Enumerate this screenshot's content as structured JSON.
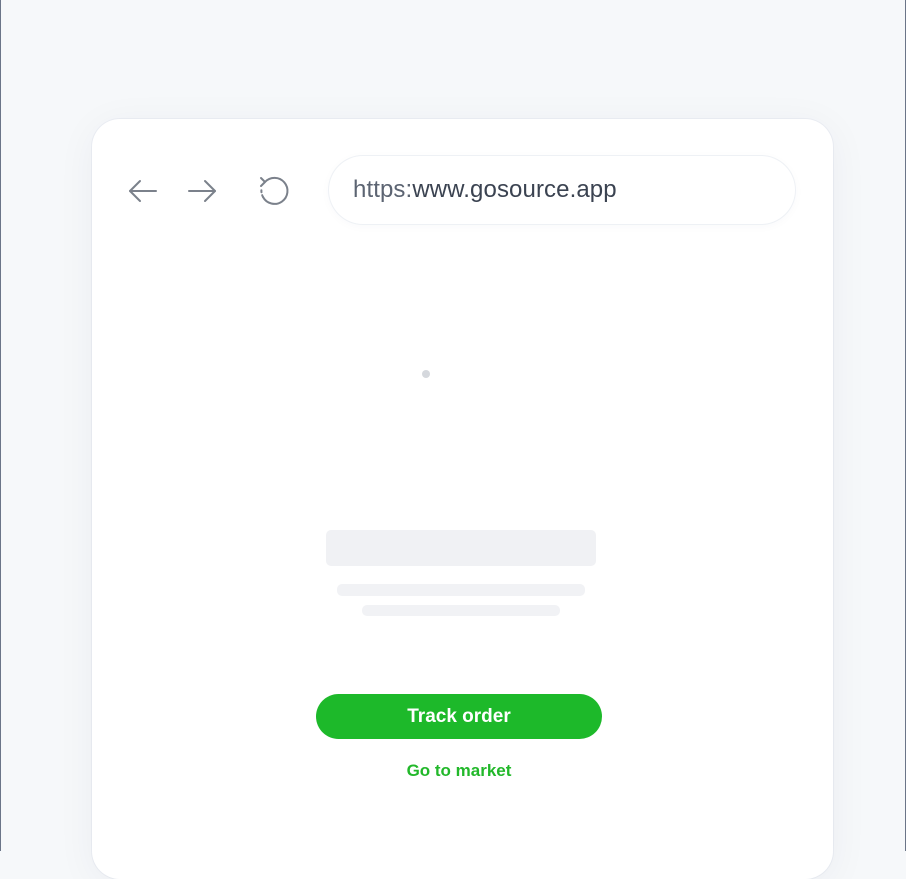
{
  "browser": {
    "url_scheme": "https:",
    "url_host": "www.gosource.app",
    "back_icon": "arrow-left-icon",
    "forward_icon": "arrow-right-icon",
    "reload_icon": "reload-icon"
  },
  "page": {
    "primary_button_label": "Track order",
    "secondary_link_label": "Go to market"
  },
  "colors": {
    "accent_green": "#1db92a",
    "link_green": "#22b82a",
    "skeleton_gray": "#f1f2f5",
    "icon_gray": "#7b818b",
    "background": "#f6f8fa"
  }
}
